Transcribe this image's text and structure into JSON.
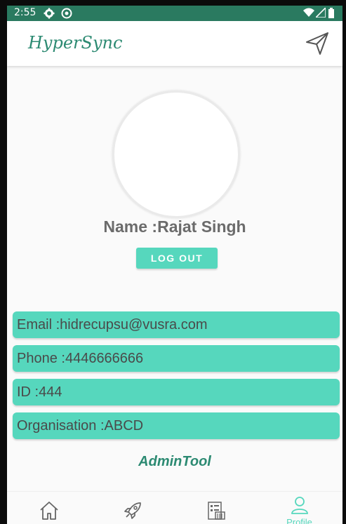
{
  "status_bar": {
    "time": "2:55"
  },
  "app_bar": {
    "title": "HyperSync"
  },
  "profile": {
    "name_text": "Name :Rajat Singh",
    "logout_label": "LOG OUT"
  },
  "fields": [
    {
      "text": "Email :hidrecupsu@vusra.com"
    },
    {
      "text": "Phone :4446666666"
    },
    {
      "text": "ID :444"
    },
    {
      "text": "Organisation :ABCD"
    }
  ],
  "admin_link": "AdminTool",
  "bottom_nav": [
    {
      "icon": "home-icon"
    },
    {
      "icon": "rocket-icon"
    },
    {
      "icon": "dashboard-icon"
    },
    {
      "icon": "profile-icon",
      "label": "Profile",
      "active": true
    }
  ],
  "colors": {
    "status_bar": "#2a7a60",
    "accent": "#56d7bd",
    "brand_text": "#2c8a72"
  }
}
